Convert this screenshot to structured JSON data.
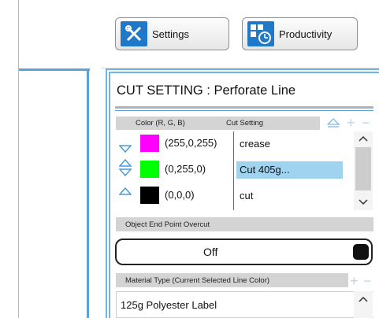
{
  "toolbar": {
    "settings_label": "Settings",
    "productivity_label": "Productivity"
  },
  "cut_setting": {
    "title": "CUT SETTING : Perforate Line",
    "header_color": "Color (R, G, B)",
    "header_cut": "Cut Setting",
    "rows": [
      {
        "color": "#ff00ff",
        "rgb": "(255,0,255)",
        "cut": "crease",
        "selected": false
      },
      {
        "color": "#00ff00",
        "rgb": "(0,255,0)",
        "cut": "Cut 405g...",
        "selected": true
      },
      {
        "color": "#000000",
        "rgb": "(0,0,0)",
        "cut": "cut",
        "selected": false
      }
    ]
  },
  "endpoint": {
    "header": "Object End Point Overcut",
    "value": "Off"
  },
  "material": {
    "header": "Material Type (Current Selected Line Color)",
    "items": [
      "125g Polyester Label"
    ]
  },
  "colors": {
    "accent": "#1f79c8",
    "panel_border": "#6fb4e2",
    "selection": "#9fd3ef",
    "arrow": "#4a9ad6"
  }
}
